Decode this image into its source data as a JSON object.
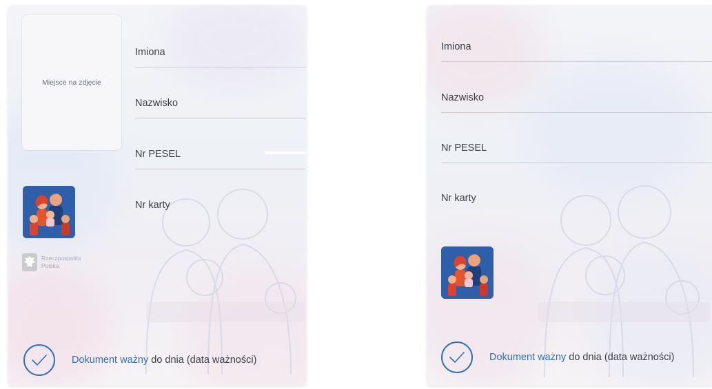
{
  "colors": {
    "accent": "#2f6fb6",
    "text": "#3a3f47",
    "line": "#c9ccd3",
    "family_bg": "#2e5fa8"
  },
  "left_card": {
    "photo_placeholder": "Miejsce na zdjęcie",
    "fields": [
      {
        "label": "Imiona"
      },
      {
        "label": "Nazwisko"
      },
      {
        "label": "Nr PESEL"
      },
      {
        "label": "Nr karty"
      }
    ],
    "emblem_text_line1": "Rzeczpospolita",
    "emblem_text_line2": "Polska",
    "validity": {
      "accent_text": "Dokument ważny",
      "rest_text": "do dnia (data ważności)"
    },
    "icons": [
      "family-icon",
      "eagle-emblem-icon",
      "check-circle-icon"
    ]
  },
  "right_card": {
    "fields": [
      {
        "label": "Imiona"
      },
      {
        "label": "Nazwisko"
      },
      {
        "label": "Nr PESEL"
      },
      {
        "label": "Nr karty"
      }
    ],
    "validity": {
      "accent_text": "Dokument ważny",
      "rest_text": "do dnia (data ważności)"
    },
    "icons": [
      "family-icon",
      "check-circle-icon"
    ]
  }
}
